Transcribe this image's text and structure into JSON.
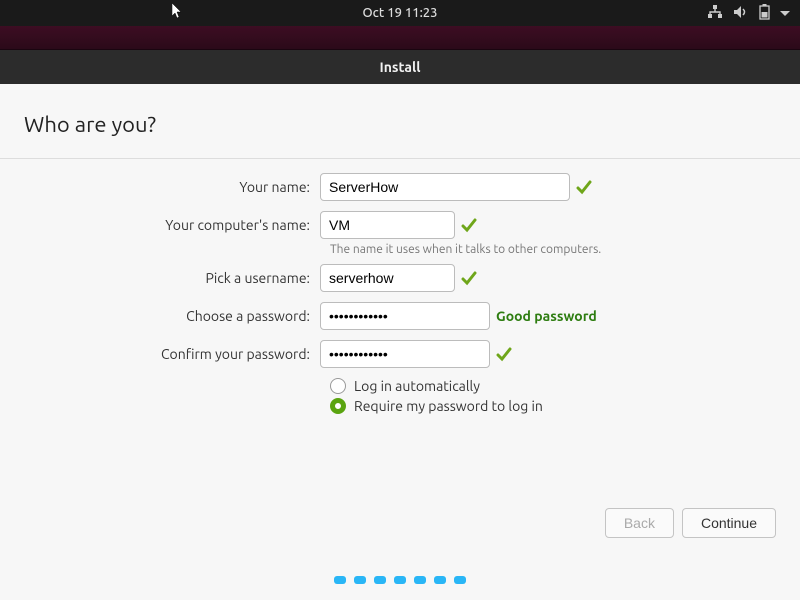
{
  "topbar": {
    "clock": "Oct 19  11:23"
  },
  "window": {
    "title": "Install"
  },
  "page": {
    "heading": "Who are you?"
  },
  "labels": {
    "name": "Your name:",
    "computer": "Your computer's name:",
    "computer_hint": "The name it uses when it talks to other computers.",
    "username": "Pick a username:",
    "password": "Choose a password:",
    "confirm": "Confirm your password:"
  },
  "values": {
    "name": "ServerHow",
    "computer": "VM",
    "username": "serverhow",
    "password": "••••••••••••",
    "confirm": "••••••••••••"
  },
  "feedback": {
    "password_strength": "Good password"
  },
  "radios": {
    "auto": "Log in automatically",
    "require": "Require my password to log in",
    "selected": "require"
  },
  "buttons": {
    "back": "Back",
    "continue": "Continue"
  },
  "progress_dots": 7
}
